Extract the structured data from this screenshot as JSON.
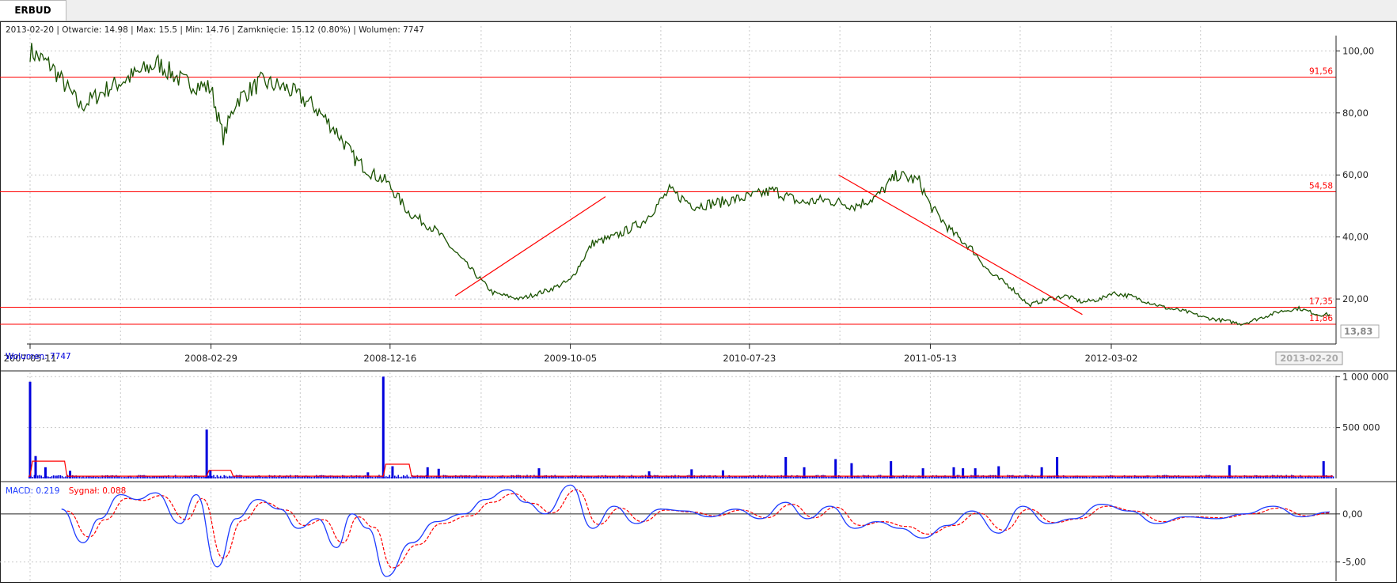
{
  "tab": {
    "label": "ERBUD"
  },
  "info_line": "2013-02-20 | Otwarcie: 14.98 | Max: 15.5 | Min: 14.76 | Zamknięcie: 15.12 (0.80%)  | Wolumen: 7747",
  "colors": {
    "price": "#1a5200",
    "level": "#ff0000",
    "volume": "#0000dd",
    "volume_ma": "#ff0000",
    "macd": "#1e3cff",
    "signal": "#ff0000",
    "grid": "#c8c8c8",
    "axis_text": "#222222"
  },
  "chart_data": [
    {
      "type": "line",
      "name": "price-panel",
      "x_ticks": [
        "2007-05-11",
        "2008-02-29",
        "2008-12-16",
        "2009-10-05",
        "2010-07-23",
        "2011-05-13",
        "2012-03-02"
      ],
      "last_date_label": "2013-02-20",
      "y_ticks": [
        "100,00",
        "80,00",
        "60,00",
        "40,00",
        "20,00"
      ],
      "y_tick_values": [
        100,
        80,
        60,
        40,
        20
      ],
      "ylim": [
        6,
        108
      ],
      "last_price_label": "13,83",
      "x": [
        "2007-05-11",
        "2007-06-15",
        "2007-08-01",
        "2007-09-15",
        "2007-10-25",
        "2007-12-05",
        "2008-01-15",
        "2008-02-29",
        "2008-03-20",
        "2008-04-10",
        "2008-05-20",
        "2008-07-01",
        "2008-08-15",
        "2008-09-20",
        "2008-10-20",
        "2008-11-20",
        "2008-12-10",
        "2009-01-15",
        "2009-03-01",
        "2009-04-15",
        "2009-06-01",
        "2009-07-15",
        "2009-09-01",
        "2009-10-05",
        "2009-11-10",
        "2009-12-15",
        "2010-02-01",
        "2010-03-15",
        "2010-04-25",
        "2010-06-01",
        "2010-07-23",
        "2010-09-01",
        "2010-10-15",
        "2010-11-20",
        "2010-12-20",
        "2011-01-10",
        "2011-02-15",
        "2011-03-20",
        "2011-04-25",
        "2011-05-13",
        "2011-06-15",
        "2011-07-20",
        "2011-08-20",
        "2011-09-20",
        "2011-10-20",
        "2011-11-20",
        "2011-12-20",
        "2012-01-15",
        "2012-02-15",
        "2012-03-02",
        "2012-04-01",
        "2012-05-01",
        "2012-06-01",
        "2012-07-01",
        "2012-08-01",
        "2012-09-01",
        "2012-10-01",
        "2012-11-01",
        "2012-12-01",
        "2013-01-01",
        "2013-02-01",
        "2013-02-20"
      ],
      "y": [
        100,
        95,
        82,
        88,
        92,
        96,
        90,
        88,
        72,
        84,
        90,
        88,
        82,
        74,
        65,
        60,
        58,
        48,
        42,
        32,
        22,
        20,
        23,
        26,
        38,
        40,
        45,
        55,
        50,
        51,
        53,
        55,
        51,
        52,
        51,
        50,
        53,
        60,
        58,
        50,
        42,
        36,
        28,
        24,
        18,
        20,
        21,
        19,
        20,
        22,
        21,
        19,
        17,
        16,
        14,
        13,
        12,
        14,
        16,
        17,
        15,
        15
      ],
      "levels": [
        {
          "label": "91,56",
          "value": 91.56
        },
        {
          "label": "54,58",
          "value": 54.58
        },
        {
          "label": "17,35",
          "value": 17.35
        },
        {
          "label": "11,86",
          "value": 11.86
        }
      ],
      "trendlines": [
        {
          "from": [
            "2009-04-01",
            21
          ],
          "to": [
            "2009-12-01",
            53
          ]
        },
        {
          "from": [
            "2010-12-15",
            60
          ],
          "to": [
            "2012-01-15",
            15
          ]
        }
      ]
    },
    {
      "type": "bar",
      "name": "volume-panel",
      "title": "Wolumen: 7747",
      "y_ticks": [
        "1 000 000",
        "500 000"
      ],
      "y_tick_values": [
        1000000,
        500000
      ],
      "ylim": [
        0,
        1010000
      ],
      "baseline": 25000,
      "spikes": [
        {
          "x": "2007-05-11",
          "value": 950000
        },
        {
          "x": "2007-05-20",
          "value": 220000
        },
        {
          "x": "2007-06-05",
          "value": 110000
        },
        {
          "x": "2007-07-15",
          "value": 75000
        },
        {
          "x": "2008-02-22",
          "value": 480000
        },
        {
          "x": "2008-02-28",
          "value": 80000
        },
        {
          "x": "2008-11-10",
          "value": 60000
        },
        {
          "x": "2008-12-05",
          "value": 1000000
        },
        {
          "x": "2008-12-20",
          "value": 120000
        },
        {
          "x": "2009-02-15",
          "value": 110000
        },
        {
          "x": "2009-03-05",
          "value": 95000
        },
        {
          "x": "2009-08-15",
          "value": 100000
        },
        {
          "x": "2010-02-10",
          "value": 70000
        },
        {
          "x": "2010-04-20",
          "value": 90000
        },
        {
          "x": "2010-06-10",
          "value": 80000
        },
        {
          "x": "2010-09-20",
          "value": 210000
        },
        {
          "x": "2010-10-20",
          "value": 110000
        },
        {
          "x": "2010-12-10",
          "value": 190000
        },
        {
          "x": "2011-01-05",
          "value": 150000
        },
        {
          "x": "2011-03-10",
          "value": 170000
        },
        {
          "x": "2011-05-01",
          "value": 100000
        },
        {
          "x": "2011-06-20",
          "value": 110000
        },
        {
          "x": "2011-07-05",
          "value": 100000
        },
        {
          "x": "2011-07-25",
          "value": 100000
        },
        {
          "x": "2011-09-01",
          "value": 120000
        },
        {
          "x": "2011-11-10",
          "value": 110000
        },
        {
          "x": "2011-12-05",
          "value": 210000
        },
        {
          "x": "2012-09-10",
          "value": 130000
        },
        {
          "x": "2013-02-10",
          "value": 170000
        }
      ],
      "ma_bumps": [
        {
          "from": "2007-05-11",
          "to": "2007-07-10",
          "value": 170000
        },
        {
          "from": "2008-02-22",
          "to": "2008-04-05",
          "value": 80000
        },
        {
          "from": "2008-12-05",
          "to": "2009-01-20",
          "value": 140000
        }
      ]
    },
    {
      "type": "line",
      "name": "macd-panel",
      "title_macd": "MACD: 0.219",
      "title_signal": "Sygnał: 0.088",
      "y_ticks": [
        "0,00",
        "-5,00"
      ],
      "y_tick_values": [
        0,
        -5
      ],
      "ylim": [
        -7,
        2.7
      ],
      "series": [
        {
          "name": "MACD",
          "x": [
            "2007-07-01",
            "2007-08-05",
            "2007-09-01",
            "2007-10-05",
            "2007-11-01",
            "2007-12-01",
            "2008-01-10",
            "2008-02-05",
            "2008-03-10",
            "2008-04-10",
            "2008-05-15",
            "2008-06-20",
            "2008-07-20",
            "2008-08-20",
            "2008-09-20",
            "2008-10-15",
            "2008-11-10",
            "2008-12-10",
            "2009-01-20",
            "2009-03-01",
            "2009-04-15",
            "2009-05-20",
            "2009-06-25",
            "2009-07-25",
            "2009-08-25",
            "2009-10-05",
            "2009-11-10",
            "2009-12-15",
            "2010-01-20",
            "2010-03-01",
            "2010-04-10",
            "2010-05-20",
            "2010-07-01",
            "2010-08-10",
            "2010-09-20",
            "2010-10-25",
            "2010-12-01",
            "2011-01-10",
            "2011-02-15",
            "2011-03-25",
            "2011-05-01",
            "2011-06-10",
            "2011-07-20",
            "2011-09-01",
            "2011-10-10",
            "2011-11-20",
            "2012-01-01",
            "2012-02-15",
            "2012-04-01",
            "2012-05-15",
            "2012-07-01",
            "2012-08-20",
            "2012-10-05",
            "2012-11-20",
            "2013-01-05",
            "2013-02-20"
          ],
          "values": [
            0.5,
            -3.0,
            -0.5,
            2.0,
            1.5,
            2.2,
            -1.0,
            2.0,
            -5.5,
            -0.5,
            1.5,
            0.5,
            -1.5,
            -0.5,
            -3.5,
            0.0,
            -1.5,
            -6.5,
            -3.0,
            -0.8,
            0.0,
            1.5,
            2.5,
            1.2,
            0.0,
            3.0,
            -1.5,
            0.8,
            -1.0,
            0.5,
            0.3,
            -0.3,
            0.5,
            -0.5,
            1.2,
            -0.5,
            0.8,
            -1.5,
            -0.8,
            -1.5,
            -2.5,
            -1.2,
            0.3,
            -2.0,
            0.8,
            -1.0,
            -0.5,
            1.0,
            0.3,
            -1.0,
            -0.3,
            -0.5,
            0.0,
            0.8,
            -0.3,
            0.2
          ]
        },
        {
          "name": "Sygnał",
          "x": [
            "2007-07-10",
            "2007-08-15",
            "2007-09-10",
            "2007-10-15",
            "2007-11-10",
            "2007-12-10",
            "2008-01-20",
            "2008-02-15",
            "2008-03-20",
            "2008-04-20",
            "2008-05-25",
            "2008-06-30",
            "2008-07-30",
            "2008-08-30",
            "2008-09-30",
            "2008-10-25",
            "2008-11-20",
            "2008-12-20",
            "2009-01-30",
            "2009-03-10",
            "2009-04-25",
            "2009-05-30",
            "2009-07-05",
            "2009-08-05",
            "2009-09-05",
            "2009-10-15",
            "2009-11-20",
            "2009-12-25",
            "2010-01-30",
            "2010-03-10",
            "2010-04-20",
            "2010-05-30",
            "2010-07-10",
            "2010-08-20",
            "2010-09-30",
            "2010-11-05",
            "2010-12-10",
            "2011-01-20",
            "2011-02-25",
            "2011-04-05",
            "2011-05-10",
            "2011-06-20",
            "2011-07-30",
            "2011-09-10",
            "2011-10-20",
            "2011-11-30",
            "2012-01-10",
            "2012-02-25",
            "2012-04-10",
            "2012-05-25",
            "2012-07-10",
            "2012-08-30",
            "2012-10-15",
            "2012-11-30",
            "2013-01-15",
            "2013-02-20"
          ],
          "values": [
            0.3,
            -2.4,
            -0.6,
            1.6,
            1.4,
            1.9,
            -0.6,
            1.6,
            -4.6,
            -0.7,
            1.2,
            0.4,
            -1.2,
            -0.6,
            -3.0,
            -0.3,
            -1.4,
            -5.6,
            -3.2,
            -1.0,
            -0.2,
            1.2,
            2.1,
            1.1,
            0.1,
            2.5,
            -1.1,
            0.6,
            -0.8,
            0.4,
            0.2,
            -0.2,
            0.4,
            -0.4,
            1.0,
            -0.4,
            0.7,
            -1.2,
            -0.8,
            -1.3,
            -2.1,
            -1.2,
            0.1,
            -1.7,
            0.5,
            -0.9,
            -0.5,
            0.8,
            0.3,
            -0.8,
            -0.3,
            -0.4,
            0.0,
            0.6,
            -0.2,
            0.1
          ]
        }
      ]
    }
  ]
}
